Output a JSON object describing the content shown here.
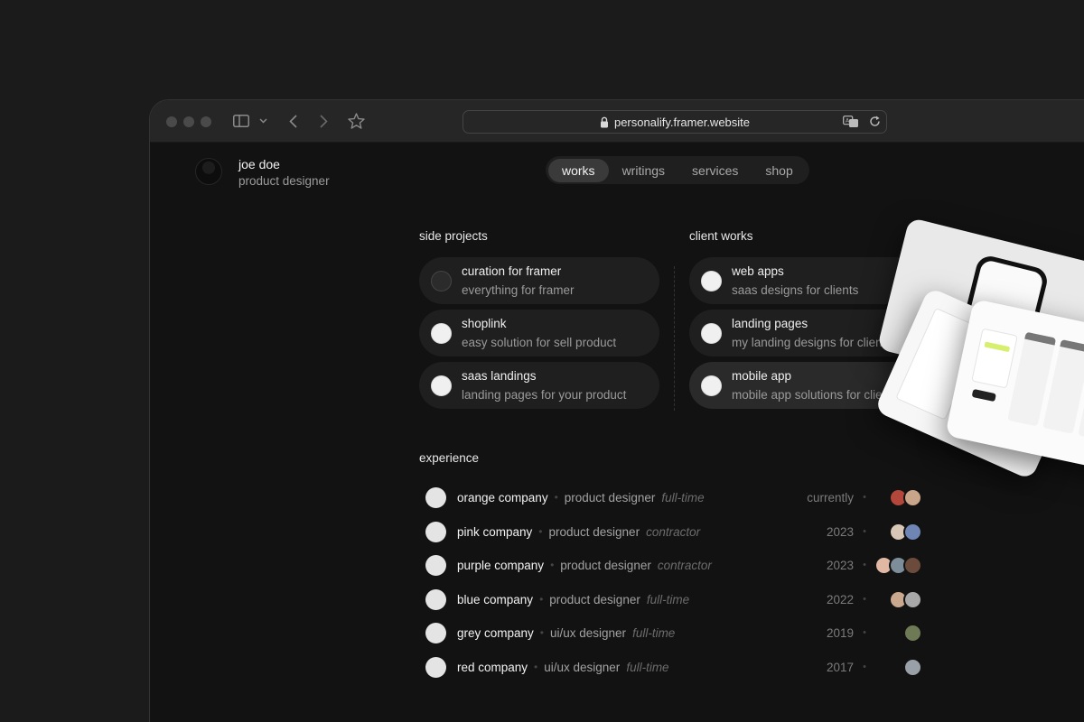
{
  "browser": {
    "url": "personalify.framer.website"
  },
  "profile": {
    "name": "joe doe",
    "role": "product designer"
  },
  "nav": {
    "items": [
      {
        "label": "works",
        "active": true
      },
      {
        "label": "writings",
        "active": false
      },
      {
        "label": "services",
        "active": false
      },
      {
        "label": "shop",
        "active": false
      }
    ]
  },
  "side_projects": {
    "title": "side projects",
    "items": [
      {
        "title": "curation for framer",
        "subtitle": "everything for framer"
      },
      {
        "title": "shoplink",
        "subtitle": "easy solution for sell product"
      },
      {
        "title": "saas landings",
        "subtitle": "landing pages for your product"
      }
    ]
  },
  "client_works": {
    "title": "client works",
    "items": [
      {
        "title": "web apps",
        "subtitle": "saas designs for clients"
      },
      {
        "title": "landing pages",
        "subtitle": "my landing designs for clients"
      },
      {
        "title": "mobile app",
        "subtitle": "mobile app solutions for clients"
      }
    ]
  },
  "experience": {
    "title": "experience",
    "rows": [
      {
        "company": "orange company",
        "role": "product designer",
        "type": "full-time",
        "year": "currently",
        "faces": [
          "#b4473b",
          "#c9a58a"
        ]
      },
      {
        "company": "pink company",
        "role": "product designer",
        "type": "contractor",
        "year": "2023",
        "faces": [
          "#d8c7b6",
          "#6f86b5"
        ]
      },
      {
        "company": "purple company",
        "role": "product designer",
        "type": "contractor",
        "year": "2023",
        "faces": [
          "#e0b8a4",
          "#7d8d9a",
          "#6b4b3b"
        ]
      },
      {
        "company": "blue company",
        "role": "product designer",
        "type": "full-time",
        "year": "2022",
        "faces": [
          "#caa890",
          "#a8a8a8"
        ]
      },
      {
        "company": "grey company",
        "role": "ui/ux designer",
        "type": "full-time",
        "year": "2019",
        "faces": [
          "#6d7a55"
        ]
      },
      {
        "company": "red company",
        "role": "ui/ux designer",
        "type": "full-time",
        "year": "2017",
        "faces": [
          "#9aa0a8"
        ]
      }
    ]
  },
  "colors": {
    "page_bg": "#1b1b1b",
    "site_bg": "#121212",
    "card_bg": "#1f1f1f",
    "nav_active": "#3a3a3a"
  }
}
